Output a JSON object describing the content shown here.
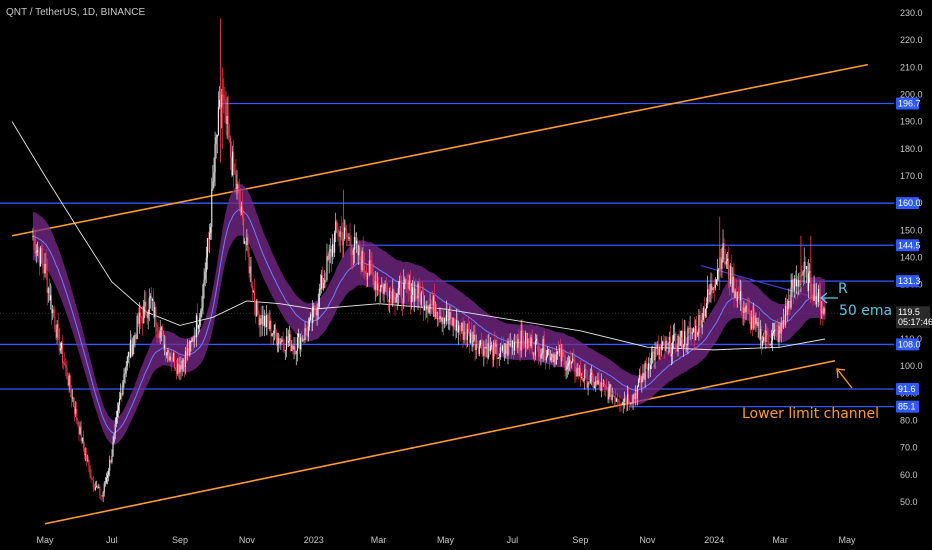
{
  "header": {
    "title": "QNT / TetherUS, 1D, BINANCE"
  },
  "colors": {
    "background": "#000000",
    "blue_line": "#2f59ff",
    "orange_line": "#ff9c2a",
    "ema_band": "#7a2a8e",
    "ema_line": "#6a7cff",
    "ma_line": "#e8e8e8",
    "bull_candle": "#ffffff",
    "bear_candle": "#ff3d55",
    "annotation_blue": "#59c6e6",
    "annotation_orange": "#ff9c2a"
  },
  "annotations": {
    "r_label": "R",
    "ema_label": "50 ema",
    "channel_label": "Lower limit channel"
  },
  "chart_data": {
    "type": "candlestick",
    "symbol": "QNT / TetherUS",
    "interval": "1D",
    "exchange": "BINANCE",
    "y_range": [
      40,
      232
    ],
    "y_ticks": [
      50,
      60,
      70,
      80,
      90,
      100,
      110,
      120,
      130,
      140,
      150,
      160,
      170,
      180,
      190,
      200,
      210,
      220,
      230
    ],
    "y_tick_labels": [
      "50.0",
      "60.0",
      "70.0",
      "80.0",
      "90.0",
      "100.0",
      "110.0",
      "120.0",
      "130.0",
      "140.0",
      "150.0",
      "160.0",
      "170.0",
      "180.0",
      "190.0",
      "200.0",
      "210.0",
      "220.0",
      "230.0"
    ],
    "x_labels": [
      "May",
      "Jul",
      "Sep",
      "Nov",
      "2023",
      "Mar",
      "May",
      "Jul",
      "Sep",
      "Nov",
      "2024",
      "Mar",
      "May"
    ],
    "horizontal_levels": [
      {
        "value": 196.7,
        "label": "196.7"
      },
      {
        "value": 160.0,
        "label": "160.0"
      },
      {
        "value": 144.5,
        "label": "144.5"
      },
      {
        "value": 131.3,
        "label": "131.3"
      },
      {
        "value": 108.0,
        "label": "108.0"
      },
      {
        "value": 91.6,
        "label": "91.6"
      },
      {
        "value": 85.1,
        "label": "85.1"
      }
    ],
    "current_price": {
      "value": 119.5,
      "label": "119.5",
      "countdown": "05:17:46"
    },
    "price_path": [
      {
        "date": "2022-04-20",
        "close": 148
      },
      {
        "date": "2022-05-01",
        "close": 135
      },
      {
        "date": "2022-05-12",
        "close": 112
      },
      {
        "date": "2022-05-25",
        "close": 90
      },
      {
        "date": "2022-06-05",
        "close": 70
      },
      {
        "date": "2022-06-14",
        "close": 57
      },
      {
        "date": "2022-06-22",
        "close": 52
      },
      {
        "date": "2022-07-01",
        "close": 68
      },
      {
        "date": "2022-07-12",
        "close": 98
      },
      {
        "date": "2022-07-25",
        "close": 116
      },
      {
        "date": "2022-08-05",
        "close": 124
      },
      {
        "date": "2022-08-18",
        "close": 108
      },
      {
        "date": "2022-08-30",
        "close": 100
      },
      {
        "date": "2022-09-10",
        "close": 106
      },
      {
        "date": "2022-09-20",
        "close": 122
      },
      {
        "date": "2022-09-28",
        "close": 150
      },
      {
        "date": "2022-10-04",
        "close": 182
      },
      {
        "date": "2022-10-09",
        "close": 200
      },
      {
        "date": "2022-10-16",
        "close": 180
      },
      {
        "date": "2022-10-24",
        "close": 162
      },
      {
        "date": "2022-11-02",
        "close": 140
      },
      {
        "date": "2022-11-10",
        "close": 120
      },
      {
        "date": "2022-11-20",
        "close": 115
      },
      {
        "date": "2022-12-01",
        "close": 110
      },
      {
        "date": "2022-12-15",
        "close": 108
      },
      {
        "date": "2022-12-28",
        "close": 114
      },
      {
        "date": "2023-01-10",
        "close": 132
      },
      {
        "date": "2023-01-22",
        "close": 150
      },
      {
        "date": "2023-02-03",
        "close": 146
      },
      {
        "date": "2023-02-15",
        "close": 138
      },
      {
        "date": "2023-03-01",
        "close": 130
      },
      {
        "date": "2023-03-15",
        "close": 127
      },
      {
        "date": "2023-04-01",
        "close": 128
      },
      {
        "date": "2023-04-20",
        "close": 122
      },
      {
        "date": "2023-05-10",
        "close": 115
      },
      {
        "date": "2023-06-01",
        "close": 108
      },
      {
        "date": "2023-06-20",
        "close": 104
      },
      {
        "date": "2023-07-05",
        "close": 110
      },
      {
        "date": "2023-07-25",
        "close": 107
      },
      {
        "date": "2023-08-15",
        "close": 103
      },
      {
        "date": "2023-09-01",
        "close": 97
      },
      {
        "date": "2023-09-20",
        "close": 92
      },
      {
        "date": "2023-10-08",
        "close": 88
      },
      {
        "date": "2023-10-20",
        "close": 89
      },
      {
        "date": "2023-11-05",
        "close": 104
      },
      {
        "date": "2023-11-25",
        "close": 108
      },
      {
        "date": "2023-12-15",
        "close": 113
      },
      {
        "date": "2023-12-29",
        "close": 128
      },
      {
        "date": "2024-01-08",
        "close": 142
      },
      {
        "date": "2024-01-18",
        "close": 130
      },
      {
        "date": "2024-02-01",
        "close": 118
      },
      {
        "date": "2024-02-15",
        "close": 110
      },
      {
        "date": "2024-03-01",
        "close": 112
      },
      {
        "date": "2024-03-12",
        "close": 128
      },
      {
        "date": "2024-03-22",
        "close": 135
      },
      {
        "date": "2024-04-02",
        "close": 127
      },
      {
        "date": "2024-04-11",
        "close": 119.5
      }
    ],
    "ma200_path": [
      {
        "date": "2022-04-01",
        "value": 190
      },
      {
        "date": "2022-05-01",
        "value": 170
      },
      {
        "date": "2022-06-01",
        "value": 150
      },
      {
        "date": "2022-07-01",
        "value": 131
      },
      {
        "date": "2022-08-01",
        "value": 120
      },
      {
        "date": "2022-09-01",
        "value": 115
      },
      {
        "date": "2022-10-01",
        "value": 118
      },
      {
        "date": "2022-11-01",
        "value": 124
      },
      {
        "date": "2022-12-01",
        "value": 123
      },
      {
        "date": "2023-01-01",
        "value": 121
      },
      {
        "date": "2023-03-01",
        "value": 123
      },
      {
        "date": "2023-05-01",
        "value": 121
      },
      {
        "date": "2023-07-01",
        "value": 117
      },
      {
        "date": "2023-09-01",
        "value": 113
      },
      {
        "date": "2023-11-01",
        "value": 107
      },
      {
        "date": "2024-01-01",
        "value": 106
      },
      {
        "date": "2024-03-01",
        "value": 107
      },
      {
        "date": "2024-04-11",
        "value": 110
      }
    ],
    "channel_upper": {
      "start": {
        "date": "2022-04-01",
        "value": 148
      },
      "end": {
        "date": "2024-05-20",
        "value": 211
      }
    },
    "channel_lower": {
      "start": {
        "date": "2022-05-01",
        "value": 42
      },
      "end": {
        "date": "2024-04-20",
        "value": 102
      }
    },
    "downtrend_line": {
      "start": {
        "date": "2023-12-20",
        "value": 137
      },
      "end": {
        "date": "2024-04-05",
        "value": 125
      }
    }
  }
}
